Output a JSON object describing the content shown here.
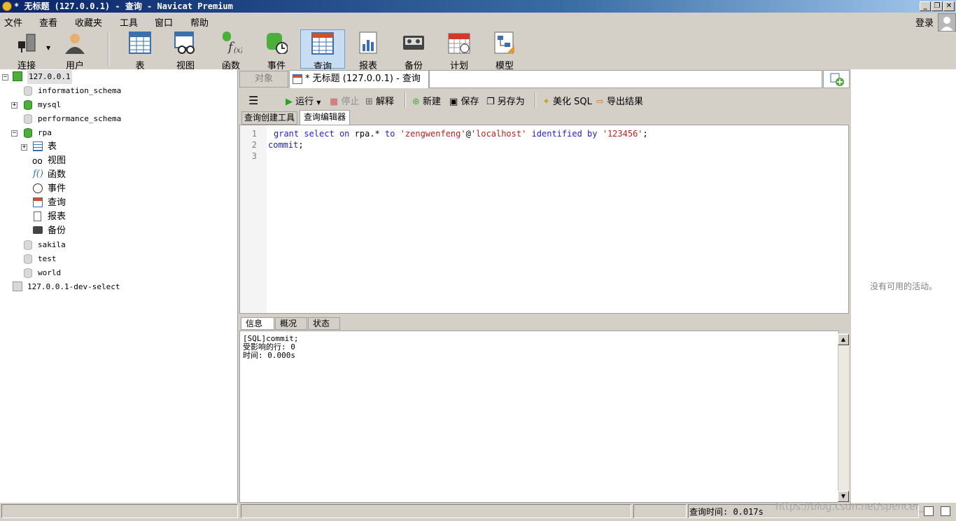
{
  "window": {
    "title": "* 无标题 (127.0.0.1) - 查询 - Navicat Premium"
  },
  "menu": [
    "文件",
    "查看",
    "收藏夹",
    "工具",
    "窗口",
    "帮助"
  ],
  "login": "登录",
  "toolbar": {
    "connect": "连接",
    "user": "用户",
    "table": "表",
    "view": "视图",
    "function": "函数",
    "event": "事件",
    "query": "查询",
    "report": "报表",
    "backup": "备份",
    "schedule": "计划",
    "model": "模型"
  },
  "tree": {
    "conn1": "127.0.0.1",
    "db_information_schema": "information_schema",
    "db_mysql": "mysql",
    "db_performance_schema": "performance_schema",
    "db_rpa": "rpa",
    "rpa_children": [
      "表",
      "视图",
      "函数",
      "事件",
      "查询",
      "报表",
      "备份"
    ],
    "db_sakila": "sakila",
    "db_test": "test",
    "db_world": "world",
    "conn2": "127.0.0.1-dev-select"
  },
  "tabs": {
    "objects": "对象",
    "query": "* 无标题 (127.0.0.1) - 查询"
  },
  "query_toolbar": {
    "run": "运行",
    "stop": "停止",
    "explain": "解释",
    "new": "新建",
    "save": "保存",
    "save_as": "另存为",
    "beautify": "美化 SQL",
    "export": "导出结果"
  },
  "subtabs": {
    "builder": "查询创建工具",
    "editor": "查询编辑器"
  },
  "editor": {
    "line_numbers": [
      "1",
      "2",
      "3"
    ],
    "tokens": [
      "grant",
      "select",
      "on",
      "rpa.*",
      "to",
      "'zengwenfeng'",
      "@",
      "'localhost'",
      "identified",
      "by",
      "'123456'",
      ";",
      "commit",
      ";"
    ]
  },
  "result_tabs": {
    "info": "信息",
    "profile": "概况",
    "status": "状态"
  },
  "messages": [
    "[SQL]commit;",
    "受影响的行: 0",
    "时间: 0.000s"
  ],
  "activity": {
    "empty": "没有可用的活动。"
  },
  "status": {
    "query_time": "查询时间: 0.017s"
  },
  "watermark": "https://blog.csdn.net/spencer_"
}
